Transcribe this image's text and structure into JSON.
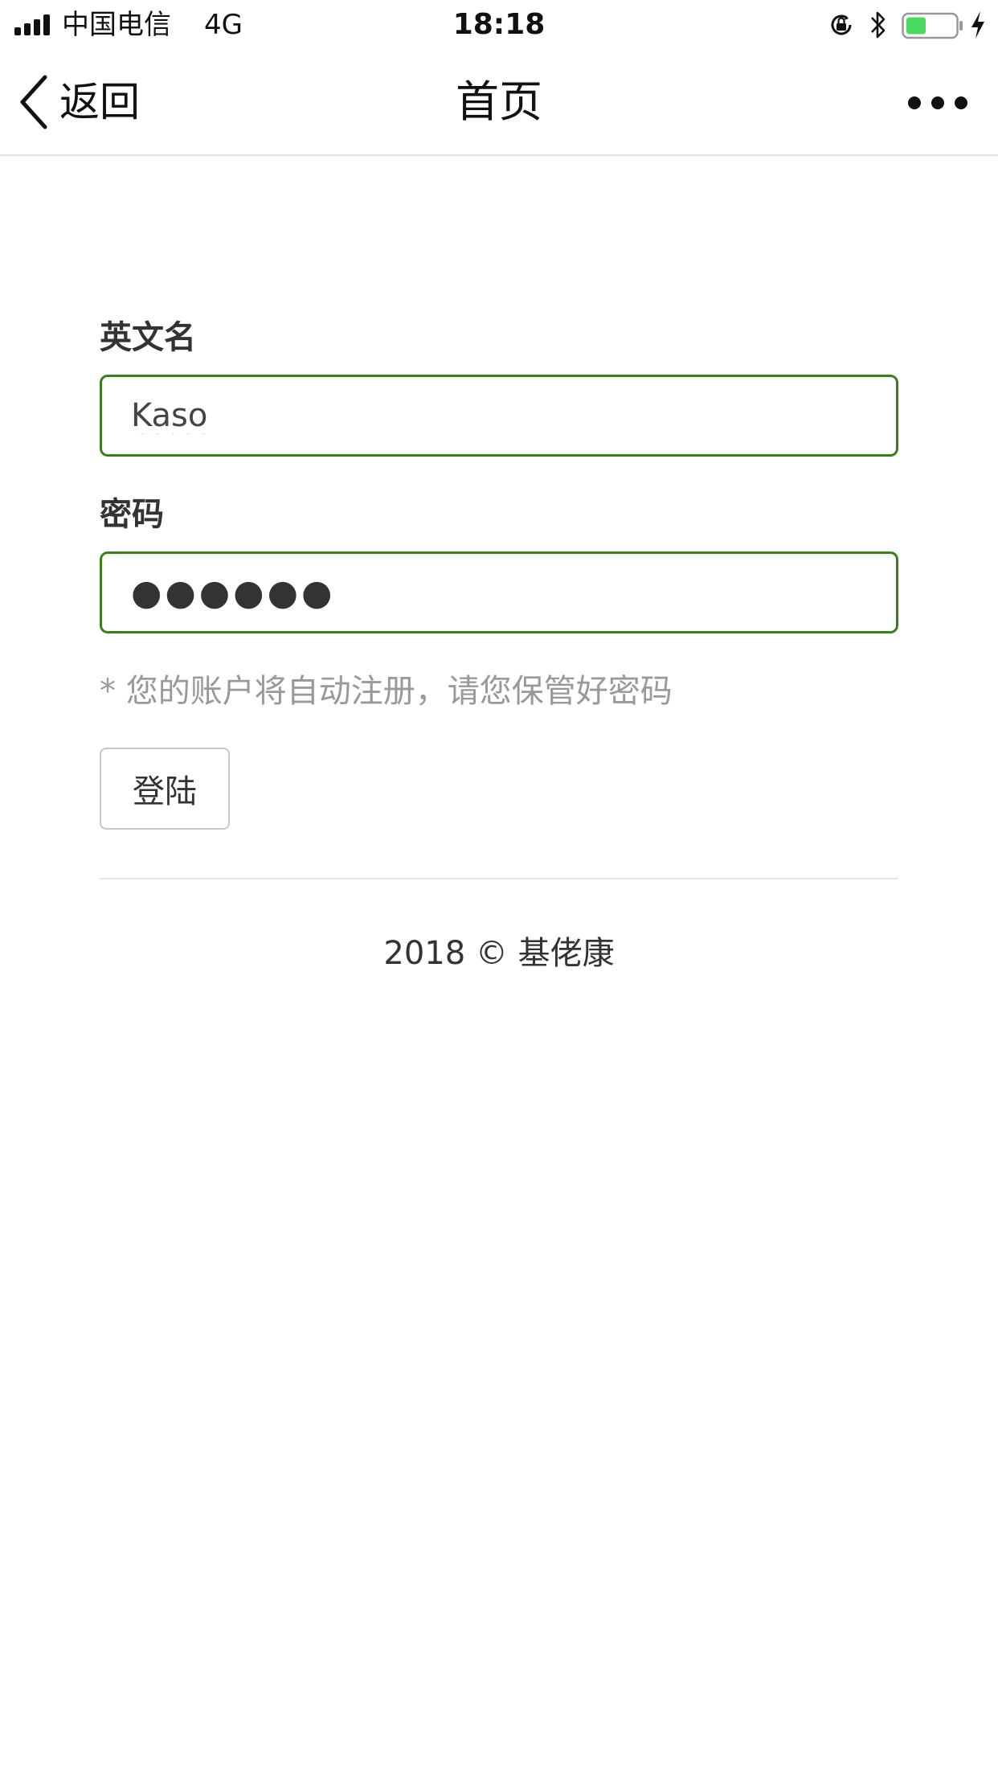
{
  "status_bar": {
    "carrier": "中国电信",
    "network": "4G",
    "time": "18:18",
    "signal_bars": 4,
    "battery_percent": 40,
    "battery_color": "#4cd964"
  },
  "nav": {
    "back_label": "返回",
    "title": "首页",
    "more_icon": "more-dots-icon"
  },
  "form": {
    "name_label": "英文名",
    "name_value": "Kaso",
    "password_label": "密码",
    "password_value": "●●●●●●",
    "hint": "* 您的账户将自动注册，请您保管好密码",
    "login_label": "登陆",
    "input_border_color": "#3c7e1f"
  },
  "footer": {
    "text": "2018 © 基佬康"
  }
}
